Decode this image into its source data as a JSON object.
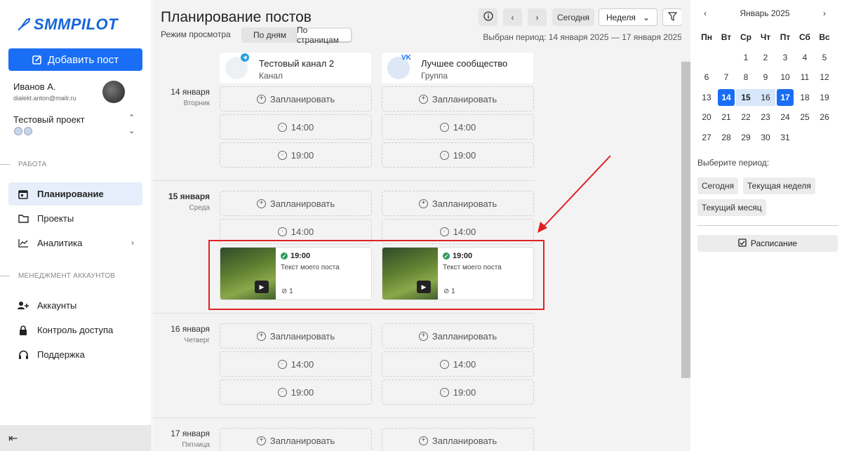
{
  "sidebar": {
    "logo": "SMMPILOT",
    "add_post": "Добавить пост",
    "user_name": "Иванов А.",
    "user_email": "dialekt.anton@mailr.ru",
    "project_name": "Тестовый проект",
    "section_work": "РАБОТА",
    "section_accounts": "МЕНЕДЖМЕНТ АККАУНТОВ",
    "nav": {
      "planning": "Планирование",
      "projects": "Проекты",
      "analytics": "Аналитика",
      "accounts": "Аккаунты",
      "access": "Контроль доступа",
      "support": "Поддержка"
    }
  },
  "header": {
    "title": "Планирование постов",
    "mode_label": "Режим просмотра",
    "mode_days": "По дням",
    "mode_pages": "По страницам",
    "today": "Сегодня",
    "view_select": "Неделя",
    "period": "Выбран период: 14 января 2025 — 17 января 2025"
  },
  "channels": [
    {
      "name": "Тестовый канал 2",
      "type": "Канал",
      "network": "telegram"
    },
    {
      "name": "Лучшее сообщество",
      "type": "Группа",
      "network": "vk"
    }
  ],
  "days": [
    {
      "date": "14 января",
      "weekday": "Вторник"
    },
    {
      "date": "15 января",
      "weekday": "Среда"
    },
    {
      "date": "16 января",
      "weekday": "Четверг"
    },
    {
      "date": "17 января",
      "weekday": "Пятница"
    }
  ],
  "slots": {
    "schedule": "Запланировать",
    "t1400": "14:00",
    "t1900": "19:00"
  },
  "post": {
    "time": "19:00",
    "text": "Текст моего поста",
    "attachments": "1"
  },
  "calendar": {
    "month": "Январь 2025",
    "weekdays": [
      "Пн",
      "Вт",
      "Ср",
      "Чт",
      "Пт",
      "Сб",
      "Вс"
    ],
    "selected_start": 14,
    "selected_end": 17
  },
  "right": {
    "period_label": "Выберите период:",
    "chip_today": "Сегодня",
    "chip_week": "Текущая неделя",
    "chip_month": "Текущий месяц",
    "schedule": "Расписание"
  },
  "colors": {
    "accent": "#1a6ef5",
    "highlight": "#e02020"
  }
}
